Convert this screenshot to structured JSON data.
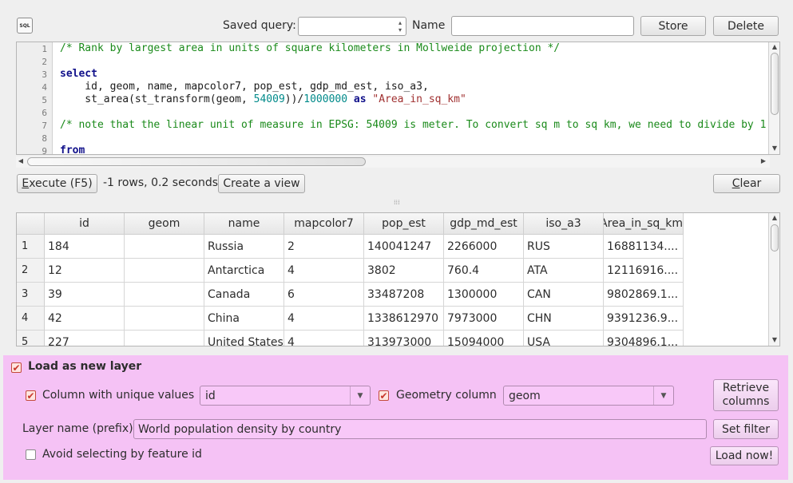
{
  "toolbar": {
    "sql_icon_text": "SQL",
    "saved_query_label": "Saved query:",
    "saved_query_value": "",
    "name_label": "Name",
    "name_value": "",
    "store_label": "Store",
    "delete_label": "Delete"
  },
  "editor": {
    "line_numbers": [
      "1",
      "2",
      "3",
      "4",
      "5",
      "6",
      "7",
      "8",
      "9"
    ],
    "lines": {
      "l1": "/* Rank by largest area in units of square kilometers in Mollweide projection */",
      "l3": "select",
      "l4": "    id, geom, name, mapcolor7, pop_est, gdp_md_est, iso_a3,",
      "l5a": "    st_area(st_transform(geom, ",
      "l5b": "54009",
      "l5c": "))/",
      "l5d": "1000000",
      "l5e": " as ",
      "l5f": "\"Area_in_sq_km\"",
      "l7": "/* note that the linear unit of measure in EPSG: 54009 is meter. To convert sq m to sq km, we need to divide by 1",
      "l9": "from"
    }
  },
  "exec": {
    "execute_prefix": "E",
    "execute_rest": "xecute (F5)",
    "status": "-1 rows, 0.2 seconds",
    "create_view_label": "Create a view",
    "clear_prefix": "C",
    "clear_rest": "lear"
  },
  "table": {
    "columns": [
      "id",
      "geom",
      "name",
      "mapcolor7",
      "pop_est",
      "gdp_md_est",
      "iso_a3",
      "Area_in_sq_km"
    ],
    "rows": [
      {
        "n": "1",
        "id": "184",
        "geom": "",
        "name": "Russia",
        "mapcolor7": "2",
        "pop_est": "140041247",
        "gdp_md_est": "2266000",
        "iso_a3": "RUS",
        "area": "16881134...."
      },
      {
        "n": "2",
        "id": "12",
        "geom": "",
        "name": "Antarctica",
        "mapcolor7": "4",
        "pop_est": "3802",
        "gdp_md_est": "760.4",
        "iso_a3": "ATA",
        "area": "12116916...."
      },
      {
        "n": "3",
        "id": "39",
        "geom": "",
        "name": "Canada",
        "mapcolor7": "6",
        "pop_est": "33487208",
        "gdp_md_est": "1300000",
        "iso_a3": "CAN",
        "area": "9802869.1..."
      },
      {
        "n": "4",
        "id": "42",
        "geom": "",
        "name": "China",
        "mapcolor7": "4",
        "pop_est": "1338612970",
        "gdp_md_est": "7973000",
        "iso_a3": "CHN",
        "area": "9391236.9..."
      },
      {
        "n": "5",
        "id": "227",
        "geom": "",
        "name": "United States",
        "mapcolor7": "4",
        "pop_est": "313973000",
        "gdp_md_est": "15094000",
        "iso_a3": "USA",
        "area": "9304896.1..."
      }
    ]
  },
  "layer": {
    "load_as_new_layer_label": "Load as new layer",
    "unique_col_label": "Column with unique values",
    "unique_col_value": "id",
    "geometry_col_label": "Geometry column",
    "geometry_col_value": "geom",
    "retrieve_label_1": "Retrieve",
    "retrieve_label_2": "columns",
    "layer_name_label": "Layer name (prefix)",
    "layer_name_value": "World population density by country",
    "set_filter_label": "Set filter",
    "avoid_label": "Avoid selecting by feature id",
    "load_now_label": "Load now!"
  },
  "colors": {
    "panel_bg": "#f5c2f5",
    "comment": "#1a8a1a",
    "keyword": "#10108a",
    "number": "#008a8a",
    "string": "#a03030"
  }
}
